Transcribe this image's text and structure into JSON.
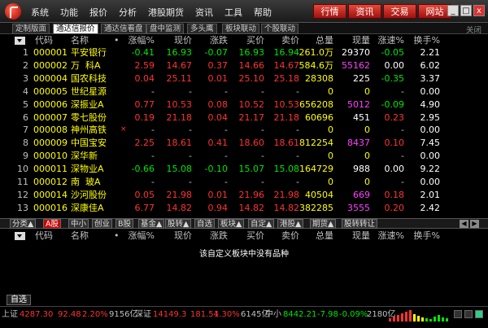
{
  "menu": [
    "系统",
    "功能",
    "报价",
    "分析",
    "港股期货",
    "资讯",
    "工具",
    "帮助"
  ],
  "top_buttons": [
    "行情",
    "资讯",
    "交易",
    "网站"
  ],
  "window_buttons": [
    "_",
    "□",
    "x"
  ],
  "top_tabs": [
    "定制版面",
    "通达信报价",
    "通达信看盘",
    "盘中监测",
    "多头鹰",
    "板块联动",
    "个股联动"
  ],
  "close_label": "关闭",
  "columns": [
    "代码",
    "名称",
    "•",
    "涨幅%",
    "现价",
    "涨跌",
    "买价",
    "卖价",
    "总量",
    "现量",
    "涨速%",
    "换手%"
  ],
  "rows": [
    {
      "idx": "1",
      "code": "000001",
      "name": "平安银行",
      "mark": "",
      "pct": "-0.41",
      "price": "16.93",
      "chg": "-0.07",
      "bid": "16.93",
      "ask": "16.94",
      "vol": "261.0万",
      "lvol": "29370",
      "speed": "-0.05",
      "turn": "2.21",
      "d": "dn"
    },
    {
      "idx": "2",
      "code": "000002",
      "name": "万  科A",
      "mark": "",
      "pct": "2.59",
      "price": "14.67",
      "chg": "0.37",
      "bid": "14.66",
      "ask": "14.67",
      "vol": "584.6万",
      "lvol": "55162",
      "speed": "0.00",
      "turn": "6.02",
      "d": "up"
    },
    {
      "idx": "3",
      "code": "000004",
      "name": "国农科技",
      "mark": "",
      "pct": "0.04",
      "price": "25.11",
      "chg": "0.01",
      "bid": "25.10",
      "ask": "25.18",
      "vol": "28308",
      "lvol": "225",
      "speed": "-0.35",
      "turn": "3.37",
      "d": "up"
    },
    {
      "idx": "4",
      "code": "000005",
      "name": "世纪星源",
      "mark": "",
      "pct": "-",
      "price": "-",
      "chg": "-",
      "bid": "-",
      "ask": "-",
      "vol": "0",
      "lvol": "0",
      "speed": "-",
      "turn": "0.00",
      "d": "na"
    },
    {
      "idx": "5",
      "code": "000006",
      "name": "深振业A",
      "mark": "",
      "pct": "0.77",
      "price": "10.53",
      "chg": "0.08",
      "bid": "10.52",
      "ask": "10.53",
      "vol": "656208",
      "lvol": "5012",
      "speed": "-0.09",
      "turn": "4.90",
      "d": "up"
    },
    {
      "idx": "6",
      "code": "000007",
      "name": "零七股份",
      "mark": "",
      "pct": "0.19",
      "price": "21.18",
      "chg": "0.04",
      "bid": "21.17",
      "ask": "21.18",
      "vol": "60696",
      "lvol": "451",
      "speed": "0.23",
      "turn": "2.95",
      "d": "up"
    },
    {
      "idx": "7",
      "code": "000008",
      "name": "神州高铁",
      "mark": "×",
      "pct": "-",
      "price": "-",
      "chg": "-",
      "bid": "-",
      "ask": "-",
      "vol": "0",
      "lvol": "0",
      "speed": "-",
      "turn": "0.00",
      "d": "na"
    },
    {
      "idx": "8",
      "code": "000009",
      "name": "中国宝安",
      "mark": "",
      "pct": "2.25",
      "price": "18.61",
      "chg": "0.41",
      "bid": "18.60",
      "ask": "18.61",
      "vol": "812254",
      "lvol": "8437",
      "speed": "0.10",
      "turn": "7.45",
      "d": "up"
    },
    {
      "idx": "9",
      "code": "000010",
      "name": "深华新",
      "mark": "",
      "pct": "-",
      "price": "-",
      "chg": "-",
      "bid": "-",
      "ask": "-",
      "vol": "0",
      "lvol": "0",
      "speed": "-",
      "turn": "0.00",
      "d": "na"
    },
    {
      "idx": "10",
      "code": "000011",
      "name": "深物业A",
      "mark": "",
      "pct": "-0.66",
      "price": "15.08",
      "chg": "-0.10",
      "bid": "15.07",
      "ask": "15.08",
      "vol": "164729",
      "lvol": "988",
      "speed": "0.00",
      "turn": "9.22",
      "d": "dn"
    },
    {
      "idx": "11",
      "code": "000012",
      "name": "南  玻A",
      "mark": "",
      "pct": "-",
      "price": "-",
      "chg": "-",
      "bid": "-",
      "ask": "-",
      "vol": "0",
      "lvol": "0",
      "speed": "-",
      "turn": "0.00",
      "d": "na"
    },
    {
      "idx": "12",
      "code": "000014",
      "name": "沙河股份",
      "mark": "",
      "pct": "0.05",
      "price": "21.98",
      "chg": "0.01",
      "bid": "21.96",
      "ask": "21.98",
      "vol": "40504",
      "lvol": "669",
      "speed": "0.18",
      "turn": "2.01",
      "d": "up"
    },
    {
      "idx": "13",
      "code": "000016",
      "name": "深康佳A",
      "mark": "",
      "pct": "6.77",
      "price": "14.82",
      "chg": "0.94",
      "bid": "14.82",
      "ask": "14.82",
      "vol": "382285",
      "lvol": "3555",
      "speed": "0.20",
      "turn": "2.42",
      "d": "up"
    }
  ],
  "mid_tabs": [
    "分类▲",
    "A股",
    "中小",
    "创业",
    "B股",
    "基金▲",
    "股转▲",
    "自选",
    "板块▲",
    "自定▲",
    "港股▲",
    "期货▲",
    "股转转让"
  ],
  "empty_message": "该自定义板块中没有品种",
  "bottom_tab": "自选",
  "status": {
    "sh_label": "上证",
    "sh_index": "4287.30",
    "sh_chg": "92.48",
    "sh_pct": "2.20%",
    "sh_amt": "9156亿",
    "sz_label": "深证",
    "sz_index": "14149.3",
    "sz_chg": "181.54",
    "sz_pct": "1.30%",
    "sz_amt": "6145亿",
    "zx_label": "中小",
    "zx_index": "8442.21",
    "zx_chg": "-7.98",
    "zx_pct": "-0.09%",
    "zx_amt": "2180亿"
  },
  "colors": {
    "up": "#ff3232",
    "down": "#00e600",
    "code": "#ffff00",
    "accent": "#c00000"
  }
}
